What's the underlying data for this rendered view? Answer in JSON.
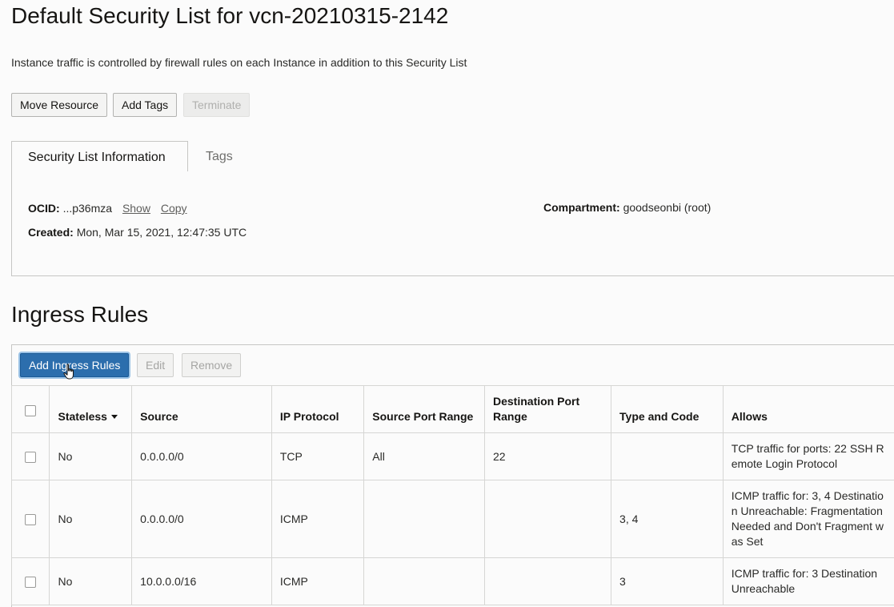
{
  "page": {
    "title": "Default Security List for vcn-20210315-2142",
    "description": "Instance traffic is controlled by firewall rules on each Instance in addition to this Security List"
  },
  "actions": {
    "move_resource": "Move Resource",
    "add_tags": "Add Tags",
    "terminate": "Terminate"
  },
  "tabs": [
    {
      "label": "Security List Information",
      "active": true
    },
    {
      "label": "Tags",
      "active": false
    }
  ],
  "info": {
    "ocid_label": "OCID:",
    "ocid_value": "...p36mza",
    "show_link": "Show",
    "copy_link": "Copy",
    "created_label": "Created:",
    "created_value": "Mon, Mar 15, 2021, 12:47:35 UTC",
    "compartment_label": "Compartment:",
    "compartment_value": "goodseonbi (root)"
  },
  "ingress": {
    "section_title": "Ingress Rules",
    "add_button": "Add Ingress Rules",
    "edit_button": "Edit",
    "remove_button": "Remove",
    "columns": {
      "stateless": "Stateless",
      "source": "Source",
      "ip_protocol": "IP Protocol",
      "source_port_range": "Source Port Range",
      "destination_port_range": "Destination Port Range",
      "type_and_code": "Type and Code",
      "allows": "Allows"
    },
    "rows": [
      {
        "stateless": "No",
        "source": "0.0.0.0/0",
        "ip_protocol": "TCP",
        "source_port_range": "All",
        "destination_port_range": "22",
        "type_and_code": "",
        "allows": "TCP traffic for ports: 22 SSH Remote Login Protocol"
      },
      {
        "stateless": "No",
        "source": "0.0.0.0/0",
        "ip_protocol": "ICMP",
        "source_port_range": "",
        "destination_port_range": "",
        "type_and_code": "3, 4",
        "allows": "ICMP traffic for: 3, 4 Destination Unreachable: Fragmentation Needed and Don't Fragment was Set"
      },
      {
        "stateless": "No",
        "source": "10.0.0.0/16",
        "ip_protocol": "ICMP",
        "source_port_range": "",
        "destination_port_range": "",
        "type_and_code": "3",
        "allows": "ICMP traffic for: 3 Destination Unreachable"
      }
    ]
  },
  "colors": {
    "primary_button": "#2c6ead",
    "focus_ring": "#9cc3e6",
    "border": "#c6c6c4",
    "background": "#fbfbfb"
  }
}
